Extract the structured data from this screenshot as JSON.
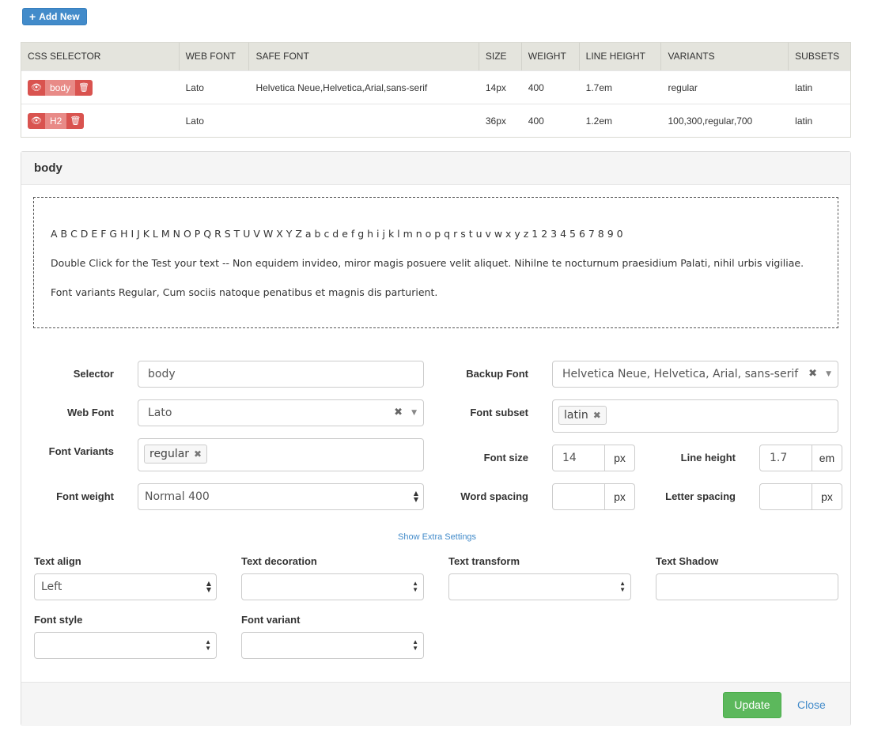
{
  "toolbar": {
    "add_label": "Add New"
  },
  "table": {
    "headers": [
      "CSS SELECTOR",
      "WEB FONT",
      "SAFE FONT",
      "SIZE",
      "WEIGHT",
      "LINE HEIGHT",
      "VARIANTS",
      "SUBSETS"
    ],
    "rows": [
      {
        "selector": "body",
        "web_font": "Lato",
        "safe_font": "Helvetica Neue,Helvetica,Arial,sans-serif",
        "size": "14px",
        "weight": "400",
        "line_height": "1.7em",
        "variants": "regular",
        "subsets": "latin"
      },
      {
        "selector": "H2",
        "web_font": "Lato",
        "safe_font": "",
        "size": "36px",
        "weight": "400",
        "line_height": "1.2em",
        "variants": "100,300,regular,700",
        "subsets": "latin"
      }
    ]
  },
  "panel": {
    "title": "body",
    "preview": {
      "alphabet": "A B C D E F G H I J K L M N O P Q R S T U V W X Y Z a b c d e f g h i j k l m n o p q r s t u v w x y z 1 2 3 4 5 6 7 8 9 0",
      "test_text": "Double Click for the Test your text -- Non equidem invideo, miror magis posuere velit aliquet. Nihilne te nocturnum praesidium Palati, nihil urbis vigiliae.",
      "variants_text": "Font variants Regular, Cum sociis natoque penatibus et magnis dis parturient."
    },
    "form": {
      "selector_label": "Selector",
      "selector_value": "body",
      "backup_font_label": "Backup Font",
      "backup_font_value": "Helvetica Neue, Helvetica, Arial, sans-serif",
      "web_font_label": "Web Font",
      "web_font_value": "Lato",
      "font_subset_label": "Font subset",
      "font_subset_chip": "latin",
      "font_variants_label": "Font Variants",
      "font_variants_chip": "regular",
      "font_size_label": "Font size",
      "font_size_value": "14",
      "font_size_unit": "px",
      "line_height_label": "Line height",
      "line_height_value": "1.7",
      "line_height_unit": "em",
      "font_weight_label": "Font weight",
      "font_weight_value": "Normal 400",
      "word_spacing_label": "Word spacing",
      "word_spacing_unit": "px",
      "letter_spacing_label": "Letter spacing",
      "letter_spacing_unit": "px",
      "extra_link": "Show Extra Settings",
      "text_align_label": "Text align",
      "text_align_value": "Left",
      "text_decoration_label": "Text decoration",
      "text_transform_label": "Text transform",
      "text_shadow_label": "Text Shadow",
      "font_style_label": "Font style",
      "font_variant_label": "Font variant"
    },
    "footer": {
      "update_label": "Update",
      "close_label": "Close"
    }
  }
}
